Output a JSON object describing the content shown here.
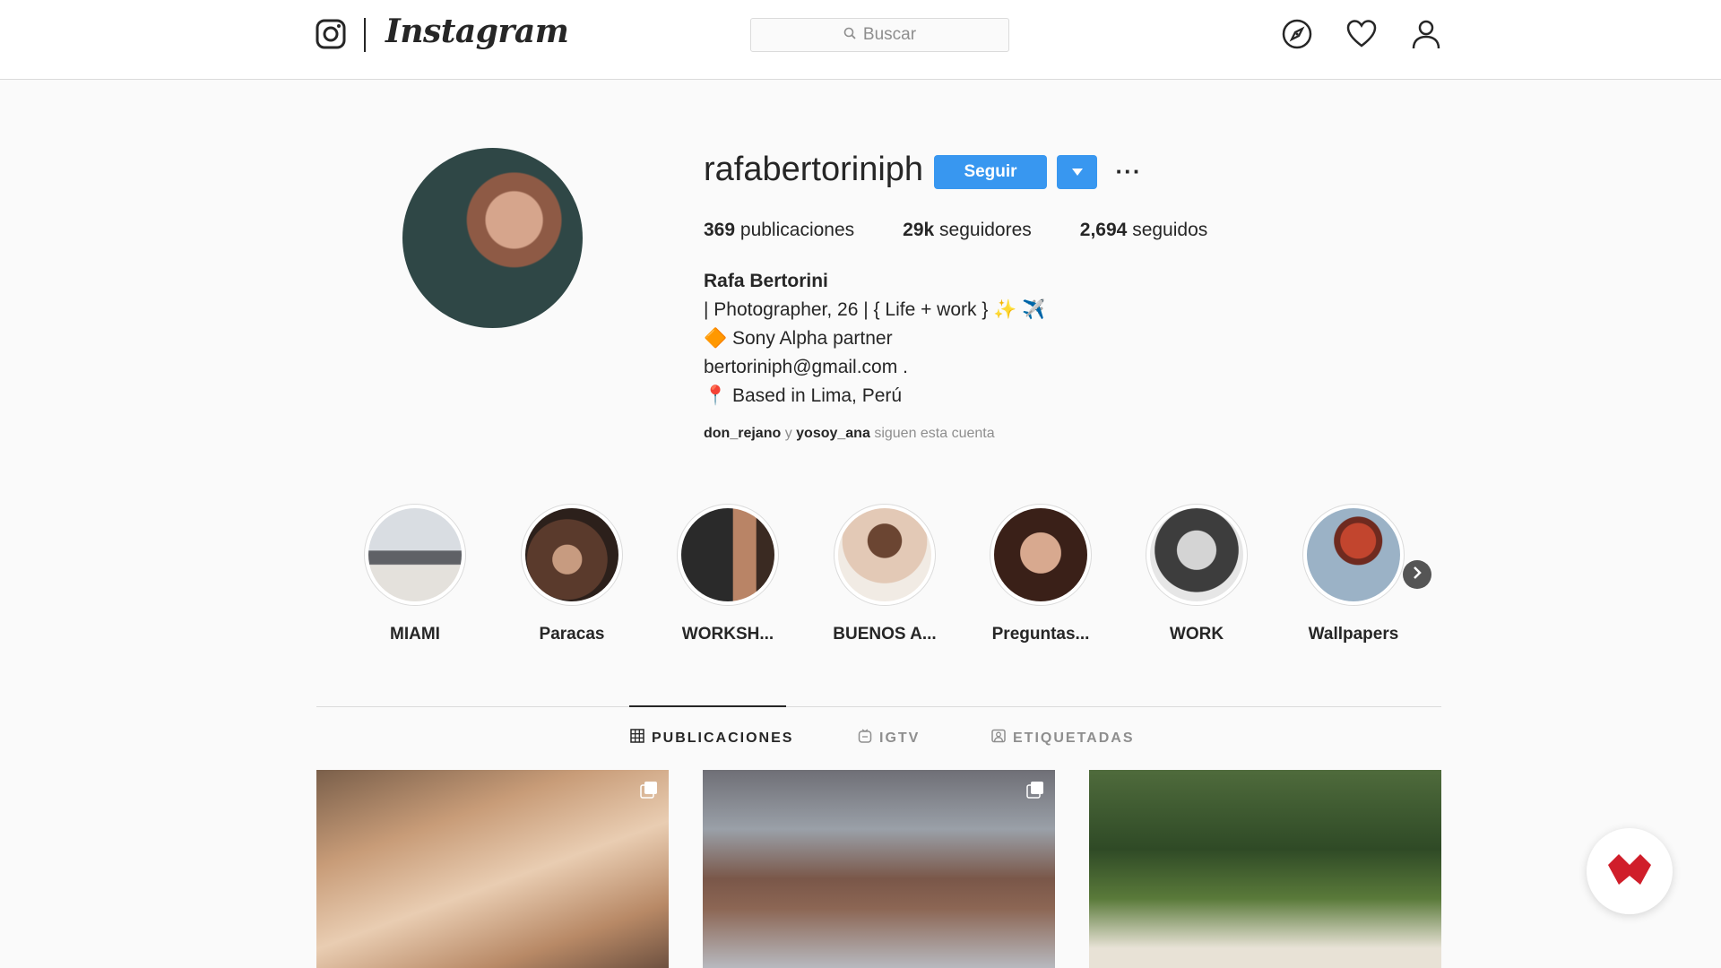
{
  "header": {
    "brand": "Instagram",
    "search_placeholder": "Buscar",
    "icons": [
      "compass-icon",
      "heart-icon",
      "user-icon"
    ]
  },
  "profile": {
    "username": "rafabertoriniph",
    "follow_label": "Seguir",
    "more_label": "···",
    "stats": {
      "posts_count": "369",
      "posts_label": "publicaciones",
      "followers_count": "29k",
      "followers_label": "seguidores",
      "following_count": "2,694",
      "following_label": "seguidos"
    },
    "full_name": "Rafa Bertorini",
    "bio_lines": [
      "| Photographer, 26 | { Life + work } ✨ ✈️",
      "🔶 Sony Alpha partner",
      "bertoriniph@gmail.com .",
      "📍 Based in Lima, Perú"
    ],
    "followed_by": {
      "user1": "don_rejano",
      "joiner": "y",
      "user2": "yosoy_ana",
      "suffix": "siguen esta cuenta"
    }
  },
  "highlights": [
    {
      "label": "MIAMI"
    },
    {
      "label": "Paracas"
    },
    {
      "label": "WORKSH..."
    },
    {
      "label": "BUENOS A..."
    },
    {
      "label": "Preguntas..."
    },
    {
      "label": "WORK"
    },
    {
      "label": "Wallpapers"
    }
  ],
  "tabs": [
    {
      "label": "PUBLICACIONES",
      "active": true
    },
    {
      "label": "IGTV",
      "active": false
    },
    {
      "label": "ETIQUETADAS",
      "active": false
    }
  ],
  "colors": {
    "accent": "#3897f0",
    "border": "#dbdbdb",
    "muted_text": "#8e8e8e",
    "badge_red": "#d01e2a"
  }
}
